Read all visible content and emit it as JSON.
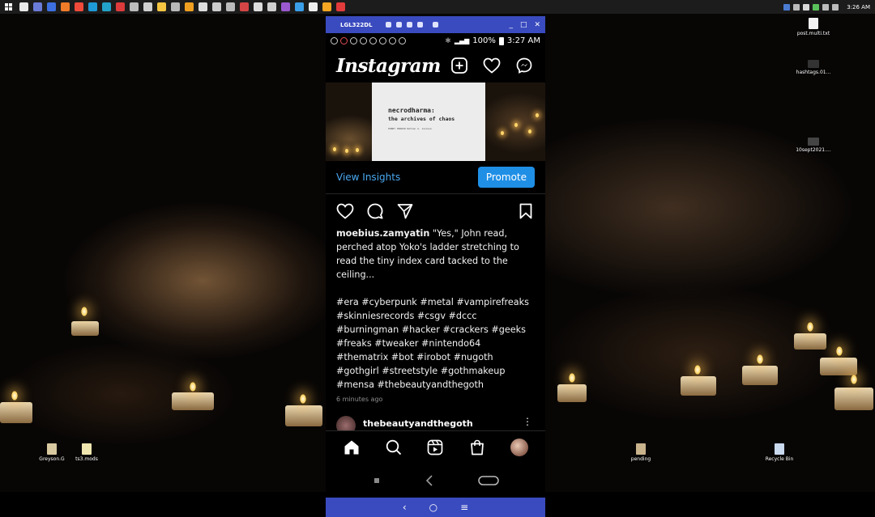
{
  "taskbar": {
    "time": "3:26 AM",
    "app_colors": [
      "#e8e8e8",
      "#6b7bd8",
      "#3d6fe0",
      "#f07b28",
      "#ef4a3a",
      "#1e9ad6",
      "#23a3c9",
      "#dd3b3b",
      "#bbbbbb",
      "#cfcfcf",
      "#f5c542",
      "#b9b9b9",
      "#f0a020",
      "#dddddd",
      "#cccccc",
      "#bbbbbb",
      "#d64545",
      "#dddddd",
      "#d0d0d0",
      "#9b59d0",
      "#3a9ee8",
      "#eeeeee",
      "#f5a623",
      "#e23b3b"
    ]
  },
  "desktop": {
    "icons": [
      {
        "label": "post.multi.txt"
      },
      {
        "label": "hashtags.01..."
      },
      {
        "label": "10sept2021...."
      },
      {
        "label": "Greyson.G"
      },
      {
        "label": "ts3.mods"
      },
      {
        "label": "pending"
      },
      {
        "label": "Recycle Bin"
      }
    ]
  },
  "emulator": {
    "title": "LGL322DL",
    "status_battery": "100%",
    "status_time": "3:27 AM",
    "nav_back": "‹",
    "nav_home": "○",
    "nav_menu": "≡"
  },
  "instagram": {
    "logo": "Instagram",
    "post_image": {
      "title": "necrodharma:",
      "subtitle": "the archives of chaos",
      "small_text": "HOBBY HORROR Nathan A. Jackson"
    },
    "insights": {
      "view_label": "View Insights",
      "promote_label": "Promote"
    },
    "caption": {
      "username": "moebius.zamyatin",
      "text": " \"Yes,\" John read, perched atop Yoko's ladder stretching to read the tiny index card tacked to the ceiling...",
      "hashtags": "#era #cyberpunk #metal #vampirefreaks #skinniesrecords #csgv #dccc #burningman #hacker #crackers #geeks #freaks #tweaker #nintendo64 #thematrix #bot #irobot #nugoth #gothgirl #streetstyle #gothmakeup #mensa #thebeautyandthegoth",
      "time_ago": "6 minutes ago"
    },
    "next_post": {
      "username": "thebeautyandthegoth",
      "menu": "⋮"
    }
  }
}
